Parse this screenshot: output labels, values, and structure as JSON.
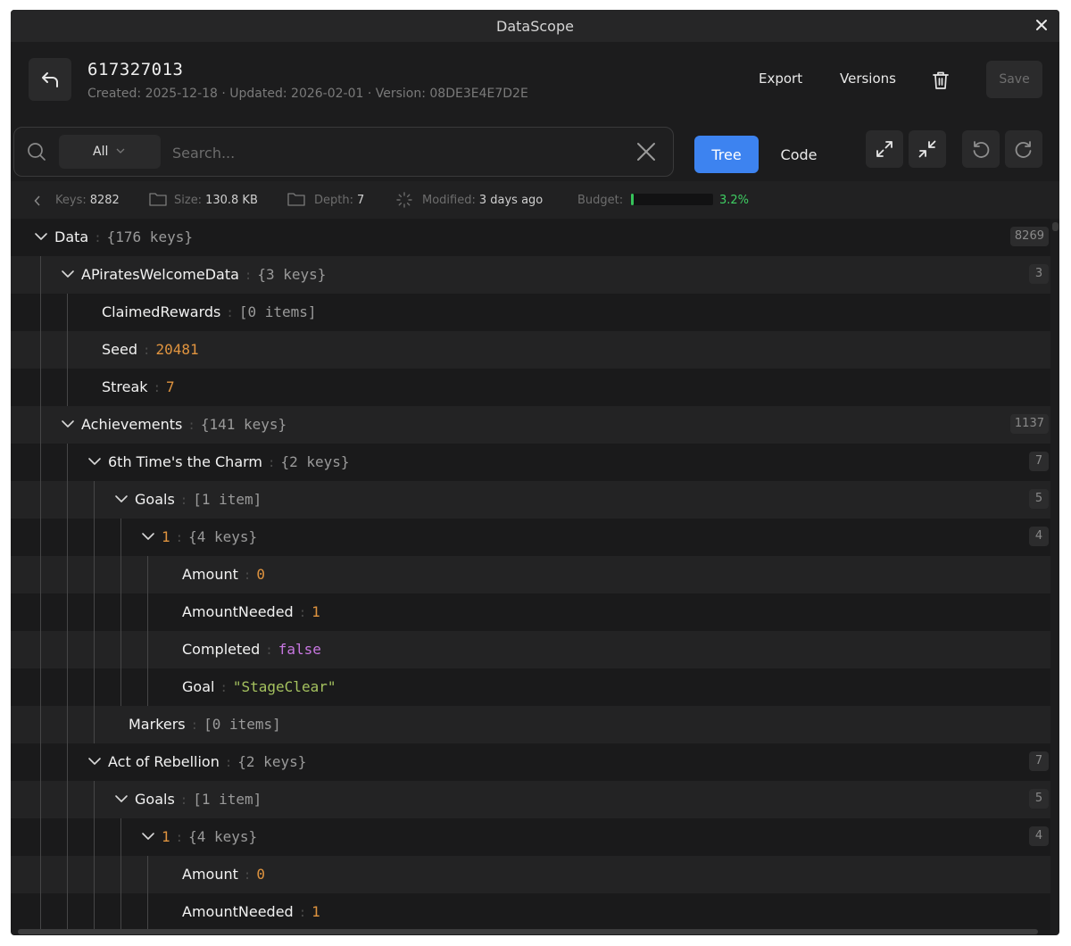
{
  "window": {
    "title": "DataScope"
  },
  "record": {
    "id": "617327013",
    "meta": "Created: 2025-12-18 · Updated: 2026-02-01 · Version: 08DE3E4E7D2E"
  },
  "header": {
    "export_label": "Export",
    "versions_label": "Versions",
    "save_label": "Save"
  },
  "search": {
    "filter_value": "All",
    "placeholder": "Search..."
  },
  "view_tabs": {
    "tree": "Tree",
    "code": "Code"
  },
  "status": {
    "keys_label": "Keys:",
    "keys_value": "8282",
    "size_label": "Size:",
    "size_value": "130.8 KB",
    "depth_label": "Depth:",
    "depth_value": "7",
    "modified_label": "Modified:",
    "modified_value": "3 days ago",
    "budget_label": "Budget:",
    "budget_pct": "3.2%",
    "budget_fraction": 0.032
  },
  "colors": {
    "accent": "#3d83f0",
    "number": "#e0943f",
    "bool": "#c777e0",
    "string": "#a5c25f",
    "budget": "#36c35a"
  },
  "tree": [
    {
      "level": 0,
      "key": "Data",
      "value": "{176 keys}",
      "type": "summary",
      "expandable": true,
      "count": "8269"
    },
    {
      "level": 1,
      "key": "APiratesWelcomeData",
      "value": "{3 keys}",
      "type": "summary",
      "expandable": true,
      "count": "3"
    },
    {
      "level": 2,
      "key": "ClaimedRewards",
      "value": "[0 items]",
      "type": "summary",
      "expandable": false
    },
    {
      "level": 2,
      "key": "Seed",
      "value": "20481",
      "type": "num",
      "expandable": false
    },
    {
      "level": 2,
      "key": "Streak",
      "value": "7",
      "type": "num",
      "expandable": false
    },
    {
      "level": 1,
      "key": "Achievements",
      "value": "{141 keys}",
      "type": "summary",
      "expandable": true,
      "count": "1137"
    },
    {
      "level": 2,
      "key": "6th Time's the Charm",
      "value": "{2 keys}",
      "type": "summary",
      "expandable": true,
      "count": "7"
    },
    {
      "level": 3,
      "key": "Goals",
      "value": "[1 item]",
      "type": "summary",
      "expandable": true,
      "count": "5"
    },
    {
      "level": 4,
      "key": "1",
      "value": "{4 keys}",
      "type": "summary",
      "expandable": true,
      "count": "4",
      "is_index": true
    },
    {
      "level": 5,
      "key": "Amount",
      "value": "0",
      "type": "num",
      "expandable": false
    },
    {
      "level": 5,
      "key": "AmountNeeded",
      "value": "1",
      "type": "num",
      "expandable": false
    },
    {
      "level": 5,
      "key": "Completed",
      "value": "false",
      "type": "bool",
      "expandable": false
    },
    {
      "level": 5,
      "key": "Goal",
      "value": "\"StageClear\"",
      "type": "str",
      "expandable": false
    },
    {
      "level": 3,
      "key": "Markers",
      "value": "[0 items]",
      "type": "summary",
      "expandable": false
    },
    {
      "level": 2,
      "key": "Act of Rebellion",
      "value": "{2 keys}",
      "type": "summary",
      "expandable": true,
      "count": "7"
    },
    {
      "level": 3,
      "key": "Goals",
      "value": "[1 item]",
      "type": "summary",
      "expandable": true,
      "count": "5"
    },
    {
      "level": 4,
      "key": "1",
      "value": "{4 keys}",
      "type": "summary",
      "expandable": true,
      "count": "4",
      "is_index": true
    },
    {
      "level": 5,
      "key": "Amount",
      "value": "0",
      "type": "num",
      "expandable": false
    },
    {
      "level": 5,
      "key": "AmountNeeded",
      "value": "1",
      "type": "num",
      "expandable": false
    }
  ]
}
